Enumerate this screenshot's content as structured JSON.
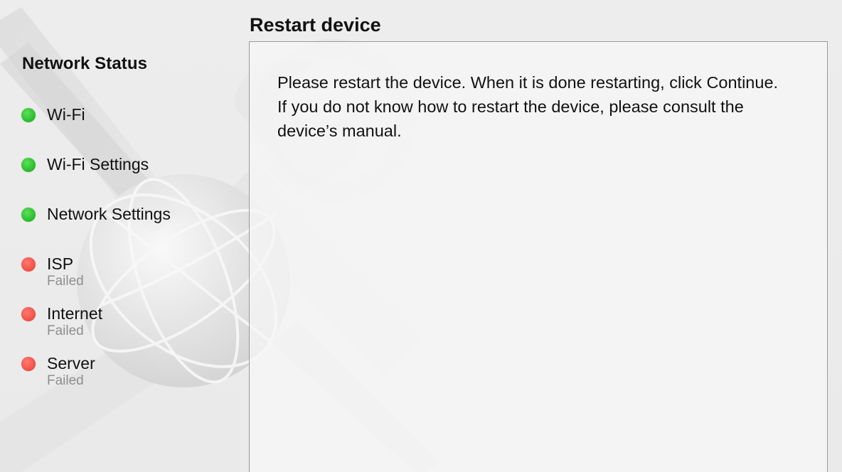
{
  "sidebar": {
    "title": "Network Status",
    "items": [
      {
        "label": "Wi-Fi",
        "state": "ok"
      },
      {
        "label": "Wi-Fi Settings",
        "state": "ok"
      },
      {
        "label": "Network Settings",
        "state": "ok"
      },
      {
        "label": "ISP",
        "state": "fail",
        "sub": "Failed"
      },
      {
        "label": "Internet",
        "state": "fail",
        "sub": "Failed"
      },
      {
        "label": "Server",
        "state": "fail",
        "sub": "Failed"
      }
    ]
  },
  "main": {
    "title": "Restart device",
    "message": "Please restart the device. When it is done restarting, click Continue. If you do not know how to restart the device, please consult the device’s manual."
  },
  "colors": {
    "ok": "#2dc02d",
    "fail": "#f4534a",
    "sub_text": "#8e8e8e"
  },
  "icons": {
    "watermark": "network-globe-wrench-icon"
  }
}
